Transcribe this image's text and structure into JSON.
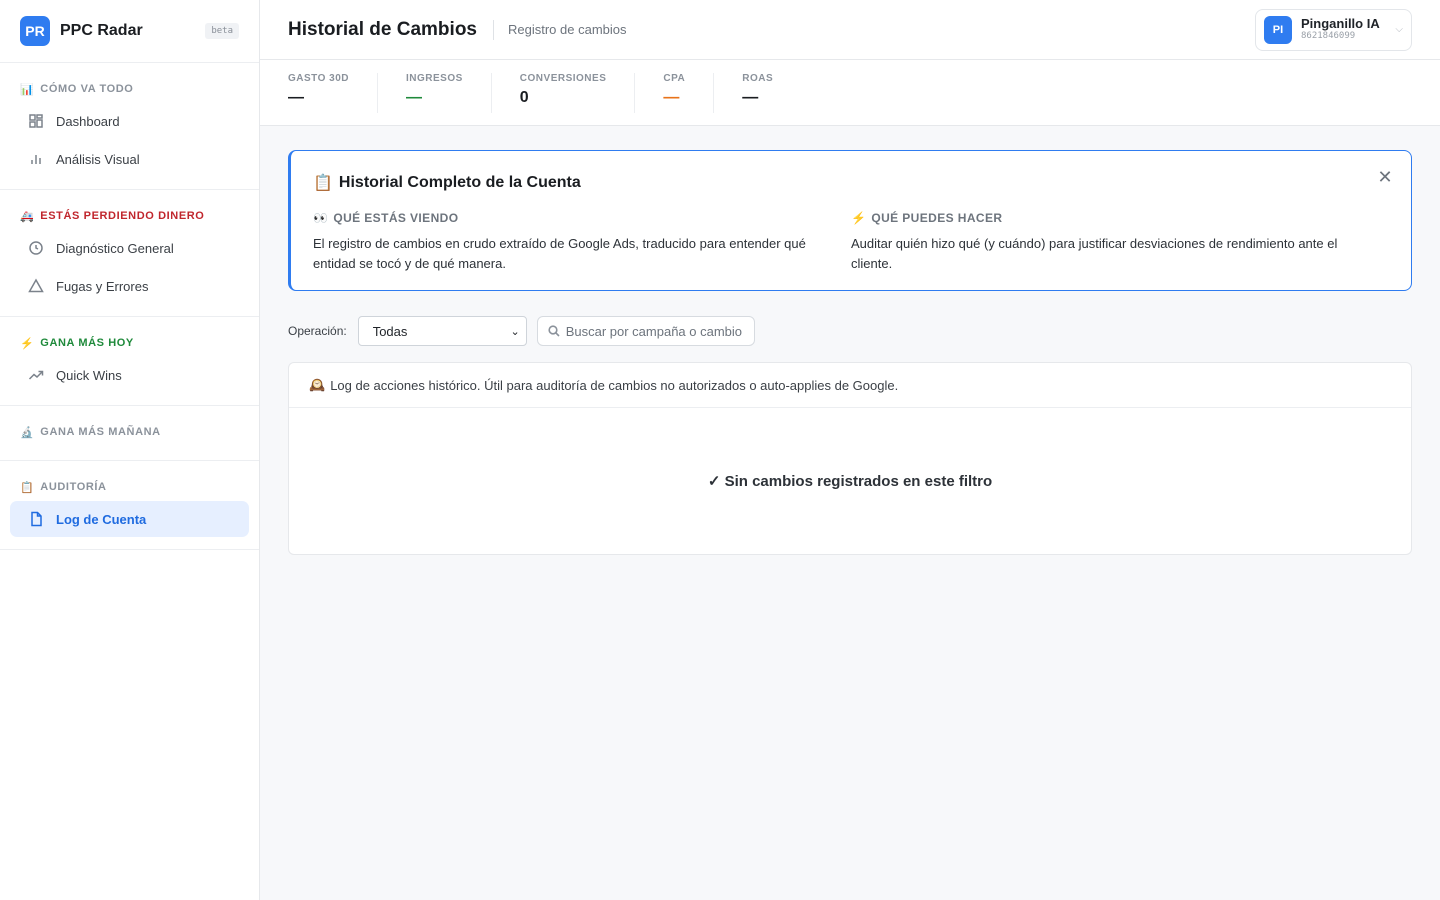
{
  "brand": {
    "logo": "PR",
    "name": "PPC Radar",
    "badge": "beta"
  },
  "sidebar": {
    "sections": [
      {
        "emoji": "📊",
        "heading": "Cómo va todo",
        "items": [
          "Dashboard",
          "Análisis Visual"
        ]
      },
      {
        "emoji": "🚑",
        "heading": "Estás perdiendo dinero",
        "items": [
          "Diagnóstico General",
          "Fugas y Errores"
        ]
      },
      {
        "emoji": "⚡",
        "heading": "Gana más hoy",
        "items": [
          "Quick Wins"
        ]
      },
      {
        "emoji": "🔬",
        "heading": "Gana más mañana",
        "items": []
      },
      {
        "emoji": "📋",
        "heading": "Auditoría",
        "items": [
          "Log de Cuenta"
        ]
      }
    ]
  },
  "header": {
    "title": "Historial de Cambios",
    "subtitle": "Registro de cambios"
  },
  "account": {
    "initials": "PI",
    "name": "Pinganillo IA",
    "id": "8621846099"
  },
  "metrics": [
    {
      "label": "Gasto 30D",
      "value": "—"
    },
    {
      "label": "Ingresos",
      "value": "—"
    },
    {
      "label": "Conversiones",
      "value": "0"
    },
    {
      "label": "CPA",
      "value": "—"
    },
    {
      "label": "ROAS",
      "value": "—"
    }
  ],
  "info": {
    "emoji": "📋",
    "title": "Historial Completo de la Cuenta",
    "close": "✕",
    "col1": {
      "emoji": "👀",
      "heading": "Qué estás viendo",
      "text": "El registro de cambios en crudo extraído de Google Ads, traducido para entender qué entidad se tocó y de qué manera."
    },
    "col2": {
      "emoji": "⚡",
      "heading": "Qué puedes hacer",
      "text": "Auditar quién hizo qué (y cuándo) para justificar desviaciones de rendimiento ante el cliente."
    }
  },
  "filters": {
    "operation_label": "Operación:",
    "operation_value": "Todas",
    "search_placeholder": "Buscar por campaña o cambio"
  },
  "log": {
    "emoji": "🕰️",
    "note": "Log de acciones histórico. Útil para auditoría de cambios no autorizados o auto-applies de Google.",
    "empty": "✓ Sin cambios registrados en este filtro"
  },
  "colors": {
    "accent": "#2f7cf0",
    "danger": "#c0262d",
    "success": "#1f8a3b",
    "warning": "#e8731a"
  }
}
